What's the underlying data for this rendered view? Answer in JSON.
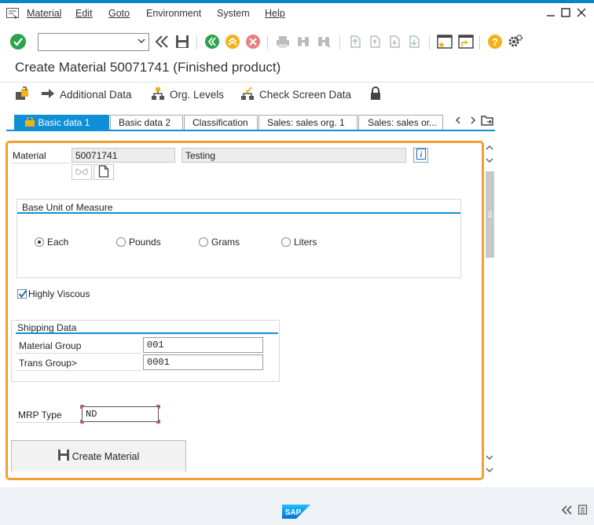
{
  "menubar": {
    "items": [
      "Material",
      "Edit",
      "Goto",
      "Environment",
      "System",
      "Help"
    ],
    "underline_index": [
      0,
      0,
      0,
      1,
      1,
      0
    ]
  },
  "toolbar": {
    "command_value": "",
    "icons": [
      "enter-icon",
      "back-icon",
      "save-icon",
      "exit-icon",
      "up-icon",
      "cancel-icon",
      "print-icon",
      "find-icon",
      "find-next-icon",
      "first-page-icon",
      "prev-page-icon",
      "next-page-icon",
      "last-page-icon",
      "new-session-icon",
      "shortcut-icon",
      "help-icon",
      "customize-icon"
    ]
  },
  "title": "Create Material 50071741 (Finished product)",
  "app_toolbar": {
    "btn1": "",
    "additional_data": "Additional Data",
    "org_levels": "Org. Levels",
    "check_screen": "Check Screen Data"
  },
  "tabs": [
    "Basic data 1",
    "Basic data 2",
    "Classification",
    "Sales: sales org. 1",
    "Sales: sales or..."
  ],
  "form": {
    "material_label": "Material",
    "material_value": "50071741",
    "material_desc": "Testing",
    "uom_title": "Base Unit of Measure",
    "uom_options": [
      {
        "label": "Each",
        "checked": true
      },
      {
        "label": "Pounds",
        "checked": false
      },
      {
        "label": "Grams",
        "checked": false
      },
      {
        "label": "Liters",
        "checked": false
      }
    ],
    "viscous_label": "Highly Viscous",
    "viscous_checked": true,
    "shipping_title": "Shipping Data",
    "material_group_label": "Material Group",
    "material_group_value": "001",
    "trans_group_label": "Trans Group>",
    "trans_group_value": "0001",
    "mrp_label": "MRP Type",
    "mrp_value": "ND",
    "create_button": "Create Material"
  },
  "colors": {
    "accent": "#0f8fd6",
    "frame": "#f0a030",
    "enter_green": "#2aa34a",
    "nav_green": "#2aa34a",
    "up_yellow": "#f2b21a",
    "cancel_red": "#e04040"
  },
  "footer": {
    "brand": "SAP"
  }
}
